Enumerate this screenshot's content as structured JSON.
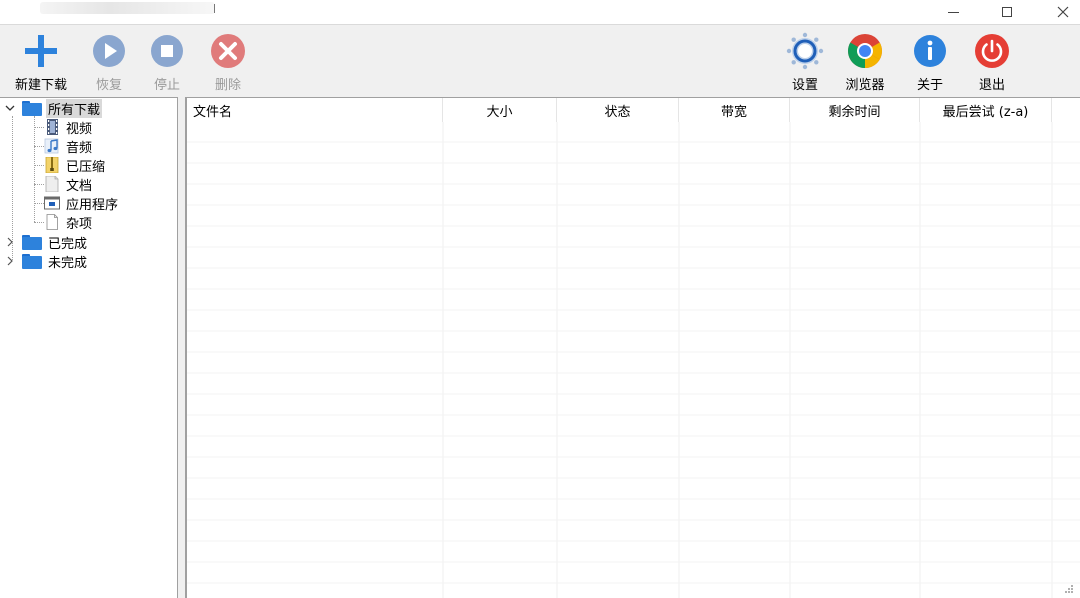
{
  "window": {
    "controls": {
      "minimize": "minimize",
      "maximize": "maximize",
      "close": "close"
    }
  },
  "toolbar": {
    "new_download": "新建下载",
    "resume": "恢复",
    "stop": "停止",
    "delete": "删除",
    "settings": "设置",
    "browser": "浏览器",
    "about": "关于",
    "exit": "退出"
  },
  "tree": {
    "all_downloads": "所有下载",
    "children": [
      "视频",
      "音频",
      "已压缩",
      "文档",
      "应用程序",
      "杂项"
    ],
    "completed": "已完成",
    "incomplete": "未完成"
  },
  "columns": [
    "文件名",
    "大小",
    "状态",
    "带宽",
    "剩余时间",
    "最后尝试 (z-a)"
  ],
  "colors": {
    "accent_blue": "#2d82dc",
    "disabled_blue": "#8aa6cf",
    "disabled_red": "#e07b7b",
    "exit_red": "#e53e35",
    "toolbar_bg": "#f0f0f0"
  }
}
